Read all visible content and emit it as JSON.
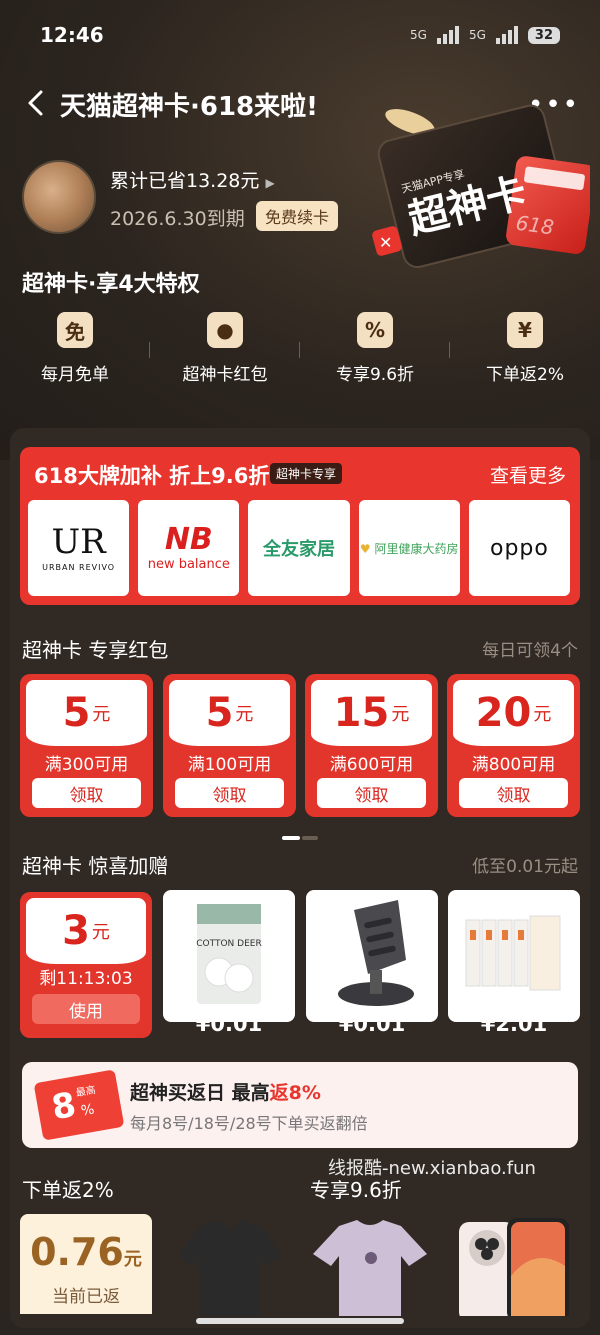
{
  "status": {
    "time": "12:46",
    "net1": "5G",
    "net2": "5G",
    "battery": "32"
  },
  "header": {
    "title": "天猫超神卡·618来啦!"
  },
  "profile": {
    "saved": "累计已省13.28元",
    "expire": "2026.6.30到期",
    "renew": "免费续卡"
  },
  "card_art": {
    "tag": "天猫APP专享",
    "name": "超神卡",
    "num": "618"
  },
  "privileges": {
    "title": "超神卡·享4大特权",
    "items": [
      {
        "icon": "免",
        "label": "每月免单"
      },
      {
        "icon": "●",
        "label": "超神卡红包"
      },
      {
        "icon": "%",
        "label": "专享9.6折"
      },
      {
        "icon": "¥",
        "label": "下单返2%"
      }
    ]
  },
  "brand": {
    "title": "618大牌加补 折上9.6折",
    "tag": "超神卡专享",
    "more": "查看更多",
    "logos": {
      "ur_main": "UR",
      "ur_sub": "URBAN REVIVO",
      "nb_main": "NB",
      "nb_sub": "new balance",
      "qy": "全友家居",
      "al": "阿里健康大药房",
      "oppo": "oppo"
    }
  },
  "redpacket": {
    "title": "超神卡 专享红包",
    "right": "每日可领4个",
    "coupons": [
      {
        "amount": "5",
        "unit": "元",
        "cond": "满300可用",
        "btn": "领取"
      },
      {
        "amount": "5",
        "unit": "元",
        "cond": "满100可用",
        "btn": "领取"
      },
      {
        "amount": "15",
        "unit": "元",
        "cond": "满600可用",
        "btn": "领取"
      },
      {
        "amount": "20",
        "unit": "元",
        "cond": "满800可用",
        "btn": "领取"
      }
    ]
  },
  "gifts": {
    "title": "超神卡 惊喜加赠",
    "right": "低至0.01元起",
    "coupon": {
      "amount": "3",
      "unit": "元",
      "time": "剩11:13:03",
      "btn": "使用"
    },
    "products": [
      {
        "name": "COTTON DEER",
        "price": "¥0.01"
      },
      {
        "price": "¥0.01"
      },
      {
        "price": "¥2.01"
      }
    ]
  },
  "banner": {
    "badge_num": "8",
    "badge_top": "最高",
    "badge_pct": "%",
    "title_a": "超神买返日 最高",
    "title_b": "返8%",
    "sub": "每月8号/18号/28号下单买返翻倍"
  },
  "watermark": "线报酷-new.xianbao.fun",
  "cashback": {
    "label": "下单返2%",
    "amount": "0.76",
    "unit": "元",
    "sub": "当前已返"
  },
  "discount": {
    "label": "专享9.6折"
  }
}
